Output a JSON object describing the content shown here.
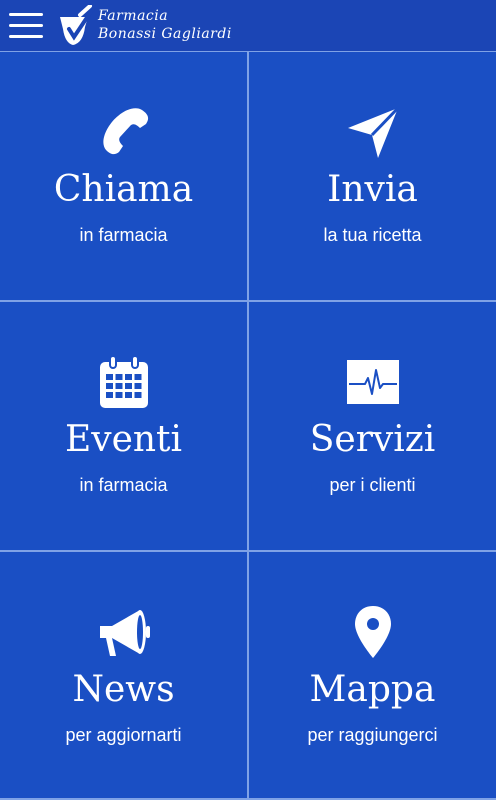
{
  "header": {
    "brand_line1": "Farmacia",
    "brand_line2": "Bonassi Gagliardi",
    "menu_icon": "hamburger-menu-icon",
    "logo_icon": "mortar-pestle-logo"
  },
  "tiles": [
    {
      "title": "Chiama",
      "subtitle": "in farmacia",
      "icon": "phone-icon"
    },
    {
      "title": "Invia",
      "subtitle": "la tua ricetta",
      "icon": "paper-plane-icon"
    },
    {
      "title": "Eventi",
      "subtitle": "in farmacia",
      "icon": "calendar-icon"
    },
    {
      "title": "Servizi",
      "subtitle": "per i clienti",
      "icon": "heartbeat-monitor-icon"
    },
    {
      "title": "News",
      "subtitle": "per aggiornarti",
      "icon": "megaphone-icon"
    },
    {
      "title": "Mappa",
      "subtitle": "per raggiungerci",
      "icon": "map-pin-icon"
    }
  ],
  "colors": {
    "background": "#1a4fc4",
    "header": "#1b45b5",
    "divider": "#7fa2e6",
    "text": "#ffffff"
  }
}
